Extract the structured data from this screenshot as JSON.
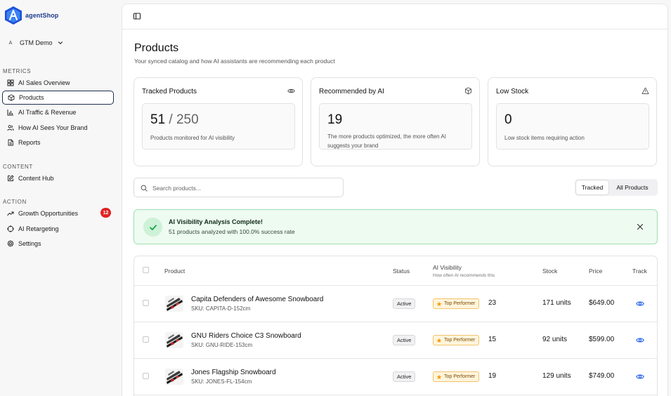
{
  "brand": {
    "name": "agentShop",
    "accent": "#2563eb"
  },
  "workspace": {
    "initial": "A",
    "name": "GTM Demo"
  },
  "sidebar": {
    "sections": [
      {
        "label": "METRICS",
        "items": [
          {
            "label": "AI Sales Overview",
            "icon": "grid-icon"
          },
          {
            "label": "Products",
            "icon": "box-icon",
            "active": true
          },
          {
            "label": "AI Traffic & Revenue",
            "icon": "bar-chart-icon"
          },
          {
            "label": "How AI Sees Your Brand",
            "icon": "users-icon"
          },
          {
            "label": "Reports",
            "icon": "file-icon"
          }
        ]
      },
      {
        "label": "CONTENT",
        "items": [
          {
            "label": "Content Hub",
            "icon": "edit-icon"
          }
        ]
      },
      {
        "label": "ACTION",
        "items": [
          {
            "label": "Growth Opportunities",
            "icon": "trending-up-icon",
            "badge": "12"
          },
          {
            "label": "AI Retargeting",
            "icon": "target-icon"
          },
          {
            "label": "Settings",
            "icon": "gear-icon"
          }
        ]
      }
    ]
  },
  "page": {
    "title": "Products",
    "subtitle": "Your synced catalog and how AI assistants are recommending each product"
  },
  "cards": [
    {
      "title": "Tracked Products",
      "value": "51",
      "value_suffix": " / 250",
      "desc": "Products monitored for AI visibility",
      "icon": "eye-icon"
    },
    {
      "title": "Recommended by AI",
      "value": "19",
      "value_suffix": "",
      "desc": "The more products optimized, the more often AI suggests your brand",
      "icon": "package-icon"
    },
    {
      "title": "Low Stock",
      "value": "0",
      "value_suffix": "",
      "desc": "Low stock items requiring action",
      "icon": "warning-icon"
    }
  ],
  "search": {
    "placeholder": "Search products..."
  },
  "filter": {
    "tracked_label": "Tracked",
    "all_label": "All Products"
  },
  "alert": {
    "title": "AI Visibility Analysis Complete!",
    "message": "51 products analyzed with 100.0% success rate"
  },
  "table": {
    "headers": {
      "product": "Product",
      "status": "Status",
      "visibility": "AI Visibility",
      "visibility_sub": "How often AI recommends this",
      "stock": "Stock",
      "price": "Price",
      "track": "Track"
    },
    "rows": [
      {
        "name": "Capita Defenders of Awesome Snowboard",
        "sku": "SKU: CAPITA-D-152cm",
        "status": "Active",
        "perf": "Top Performer",
        "score": "23",
        "stock": "171 units",
        "price": "$649.00"
      },
      {
        "name": "GNU Riders Choice C3 Snowboard",
        "sku": "SKU: GNU-RIDE-153cm",
        "status": "Active",
        "perf": "Top Performer",
        "score": "15",
        "stock": "92 units",
        "price": "$599.00"
      },
      {
        "name": "Jones Flagship Snowboard",
        "sku": "SKU: JONES-FL-154cm",
        "status": "Active",
        "perf": "Top Performer",
        "score": "19",
        "stock": "129 units",
        "price": "$749.00"
      }
    ]
  }
}
